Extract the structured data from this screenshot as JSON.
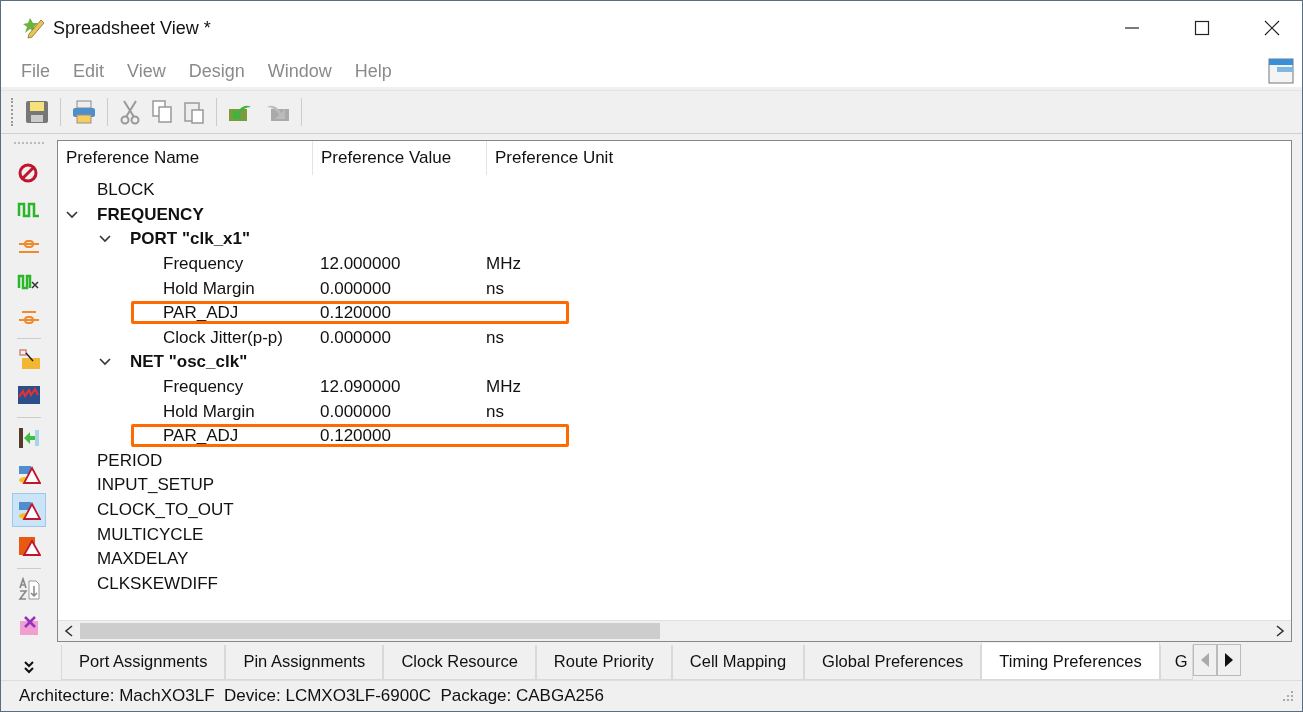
{
  "window": {
    "title": "Spreadsheet View *"
  },
  "menu": [
    "File",
    "Edit",
    "View",
    "Design",
    "Window",
    "Help"
  ],
  "sidebar_tools": [
    {
      "selected": false
    },
    {
      "selected": false
    },
    {
      "selected": false
    },
    {
      "selected": false
    },
    {
      "selected": false
    },
    {
      "selected": false
    },
    {
      "selected": false
    },
    {
      "selected": false
    },
    {
      "selected": false
    },
    {
      "selected": true
    },
    {
      "selected": false
    },
    {
      "selected": false
    },
    {
      "selected": false
    }
  ],
  "table": {
    "columns": [
      "Preference Name",
      "Preference Value",
      "Preference Unit"
    ],
    "rows": [
      {
        "name": "BLOCK",
        "bold": false
      },
      {
        "name": "FREQUENCY",
        "bold": true,
        "expanded": true,
        "children": [
          {
            "name": "PORT \"clk_x1\"",
            "bold": true,
            "expanded": true,
            "children": [
              {
                "name": "Frequency",
                "value": "12.000000",
                "unit": "MHz",
                "highlighted": false
              },
              {
                "name": "Hold Margin",
                "value": "0.000000",
                "unit": "ns",
                "highlighted": false
              },
              {
                "name": "PAR_ADJ",
                "value": "0.120000",
                "highlighted": true
              },
              {
                "name": "Clock Jitter(p-p)",
                "value": "0.000000",
                "unit": "ns",
                "highlighted": false
              }
            ]
          },
          {
            "name": "NET \"osc_clk\"",
            "bold": true,
            "expanded": true,
            "children": [
              {
                "name": "Frequency",
                "value": "12.090000",
                "unit": "MHz",
                "highlighted": false
              },
              {
                "name": "Hold Margin",
                "value": "0.000000",
                "unit": "ns",
                "highlighted": false
              },
              {
                "name": "PAR_ADJ",
                "value": "0.120000",
                "highlighted": true
              }
            ]
          }
        ]
      },
      {
        "name": "PERIOD",
        "bold": false
      },
      {
        "name": "INPUT_SETUP",
        "bold": false
      },
      {
        "name": "CLOCK_TO_OUT",
        "bold": false
      },
      {
        "name": "MULTICYCLE",
        "bold": false
      },
      {
        "name": "MAXDELAY",
        "bold": false
      },
      {
        "name": "CLKSKEWDIFF",
        "bold": false
      }
    ]
  },
  "tabs": [
    {
      "label": "Port Assignments",
      "selected": false
    },
    {
      "label": "Pin Assignments",
      "selected": false
    },
    {
      "label": "Clock Resource",
      "selected": false
    },
    {
      "label": "Route Priority",
      "selected": false
    },
    {
      "label": "Cell Mapping",
      "selected": false
    },
    {
      "label": "Global Preferences",
      "selected": false
    },
    {
      "label": "Timing Preferences",
      "selected": true
    },
    {
      "label": "G",
      "selected": false
    }
  ],
  "status_bar": "Architecture: MachXO3LF  Device: LCMXO3LF-6900C  Package: CABGA256"
}
